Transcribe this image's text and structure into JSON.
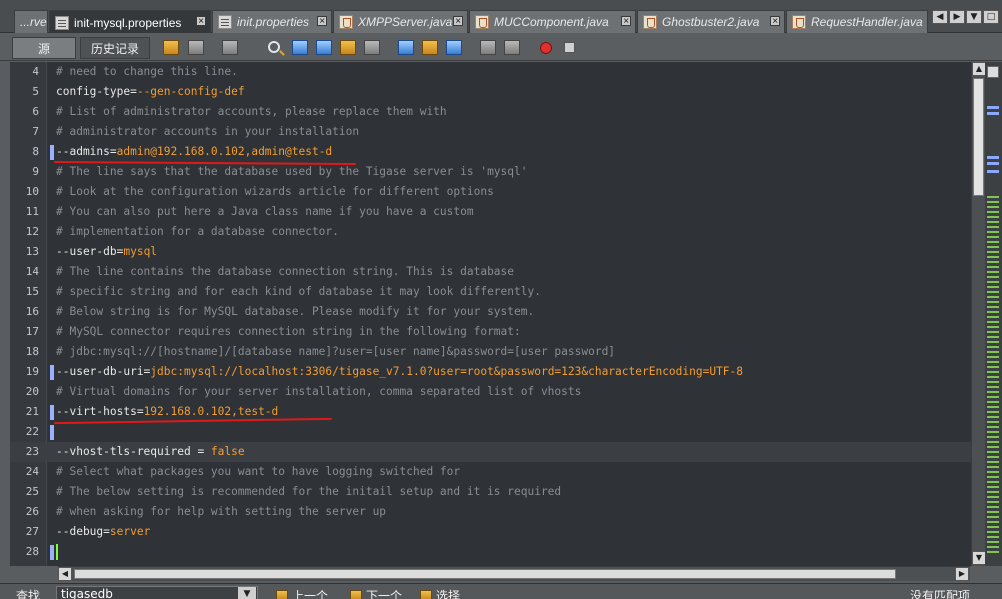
{
  "tabs": [
    {
      "label": "...rver",
      "icon": "java-file-icon",
      "active": false
    },
    {
      "label": "init-mysql.properties",
      "icon": "properties-file-icon",
      "active": true
    },
    {
      "label": "init.properties",
      "icon": "properties-file-icon",
      "active": false
    },
    {
      "label": "XMPPServer.java",
      "icon": "java-file-icon",
      "active": false
    },
    {
      "label": "MUCComponent.java",
      "icon": "java-file-icon",
      "active": false
    },
    {
      "label": "Ghostbuster2.java",
      "icon": "java-file-icon",
      "active": false
    },
    {
      "label": "RequestHandler.java",
      "icon": "java-file-icon",
      "active": false
    }
  ],
  "toolbar": {
    "source_label": "源",
    "history_label": "历史记录"
  },
  "lines": [
    {
      "n": "4",
      "segs": [
        {
          "c": "cm",
          "t": "# need to change this line."
        }
      ]
    },
    {
      "n": "5",
      "segs": [
        {
          "c": "k",
          "t": "config-type="
        },
        {
          "c": "v",
          "t": "--gen-config-def"
        }
      ]
    },
    {
      "n": "6",
      "segs": [
        {
          "c": "cm",
          "t": "# List of administrator accounts, please replace them with"
        }
      ]
    },
    {
      "n": "7",
      "segs": [
        {
          "c": "cm",
          "t": "# administrator accounts in your installation"
        }
      ]
    },
    {
      "n": "8",
      "segs": [
        {
          "c": "k",
          "t": "--admins="
        },
        {
          "c": "v",
          "t": "admin@192.168.0.102,admin@test-d"
        }
      ],
      "mark": true
    },
    {
      "n": "9",
      "segs": [
        {
          "c": "cm",
          "t": "# The line says that the database used by the Tigase server is 'mysql'"
        }
      ]
    },
    {
      "n": "10",
      "segs": [
        {
          "c": "cm",
          "t": "# Look at the configuration wizards article for different options"
        }
      ]
    },
    {
      "n": "11",
      "segs": [
        {
          "c": "cm",
          "t": "# You can also put here a Java class name if you have a custom"
        }
      ]
    },
    {
      "n": "12",
      "segs": [
        {
          "c": "cm",
          "t": "# implementation for a database connector."
        }
      ]
    },
    {
      "n": "13",
      "segs": [
        {
          "c": "k",
          "t": "--user-db="
        },
        {
          "c": "v",
          "t": "mysql"
        }
      ]
    },
    {
      "n": "14",
      "segs": [
        {
          "c": "cm",
          "t": "# The line contains the database connection string. This is database"
        }
      ]
    },
    {
      "n": "15",
      "segs": [
        {
          "c": "cm",
          "t": "# specific string and for each kind of database it may look differently."
        }
      ]
    },
    {
      "n": "16",
      "segs": [
        {
          "c": "cm",
          "t": "# Below string is for MySQL database. Please modify it for your system."
        }
      ]
    },
    {
      "n": "17",
      "segs": [
        {
          "c": "cm",
          "t": "# MySQL connector requires connection string in the following format:"
        }
      ]
    },
    {
      "n": "18",
      "segs": [
        {
          "c": "cm",
          "t": "# jdbc:mysql://[hostname]/[database name]?user=[user name]&password=[user password]"
        }
      ]
    },
    {
      "n": "19",
      "segs": [
        {
          "c": "k",
          "t": "--user-db-uri="
        },
        {
          "c": "v",
          "t": "jdbc:mysql://localhost:3306/tigase_v7.1.0?user=root&password=123&characterEncoding=UTF-8"
        }
      ],
      "mark": true
    },
    {
      "n": "20",
      "segs": [
        {
          "c": "cm",
          "t": "# Virtual domains for your server installation, comma separated list of vhosts"
        }
      ]
    },
    {
      "n": "21",
      "segs": [
        {
          "c": "k",
          "t": "--virt-hosts="
        },
        {
          "c": "v",
          "t": "192.168.0.102,test-d"
        }
      ],
      "mark": true
    },
    {
      "n": "22",
      "segs": [],
      "mark": true
    },
    {
      "n": "23",
      "segs": [
        {
          "c": "k",
          "t": "--vhost-tls-required = "
        },
        {
          "c": "v",
          "t": "false"
        }
      ],
      "cur": true
    },
    {
      "n": "24",
      "segs": [
        {
          "c": "cm",
          "t": "# Select what packages you want to have logging switched for"
        }
      ]
    },
    {
      "n": "25",
      "segs": [
        {
          "c": "cm",
          "t": "# The below setting is recommended for the initail setup and it is required"
        }
      ]
    },
    {
      "n": "26",
      "segs": [
        {
          "c": "cm",
          "t": "# when asking for help with setting the server up"
        }
      ]
    },
    {
      "n": "27",
      "segs": [
        {
          "c": "k",
          "t": "--debug="
        },
        {
          "c": "v",
          "t": "server"
        }
      ]
    },
    {
      "n": "28",
      "segs": [],
      "mark": true
    }
  ],
  "find": {
    "label": "查找",
    "value": "tigasedb",
    "prev_label": "上一个",
    "next_label": "下一个",
    "select_label": "选择",
    "status": "没有匹配项"
  },
  "colors": {
    "comment": "#8a8e90",
    "key": "#e8e8e8",
    "value": "#f29d32",
    "annotation": "#e21818"
  }
}
